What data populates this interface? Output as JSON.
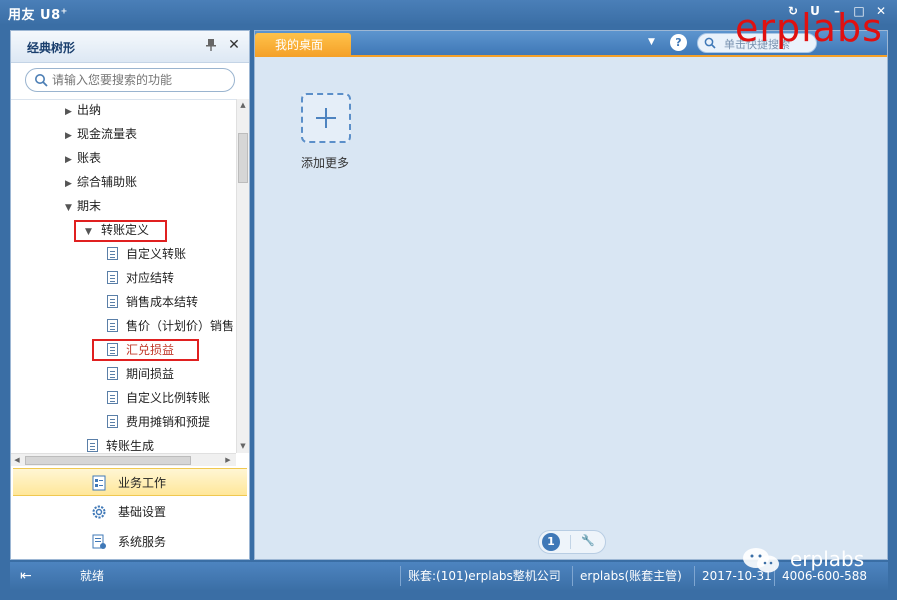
{
  "app": {
    "title": "用友 U8",
    "title_sup": "+"
  },
  "window_controls": [
    "↻",
    "U",
    "–",
    "□",
    "✕"
  ],
  "left_panel": {
    "title": "经典树形",
    "search_placeholder": "请输入您要搜索的功能",
    "tree": [
      {
        "label": "出纳",
        "type": "folder",
        "state": "collapsed"
      },
      {
        "label": "现金流量表",
        "type": "folder",
        "state": "collapsed"
      },
      {
        "label": "账表",
        "type": "folder",
        "state": "collapsed"
      },
      {
        "label": "综合辅助账",
        "type": "folder",
        "state": "collapsed"
      },
      {
        "label": "期末",
        "type": "folder",
        "state": "expanded"
      },
      {
        "label": "转账定义",
        "type": "folder",
        "state": "expanded",
        "highlight": true
      },
      {
        "label": "自定义转账",
        "type": "doc"
      },
      {
        "label": "对应结转",
        "type": "doc"
      },
      {
        "label": "销售成本结转",
        "type": "doc"
      },
      {
        "label": "售价（计划价）销售",
        "type": "doc"
      },
      {
        "label": "汇兑损益",
        "type": "doc",
        "highlight": true
      },
      {
        "label": "期间损益",
        "type": "doc"
      },
      {
        "label": "自定义比例转账",
        "type": "doc"
      },
      {
        "label": "费用摊销和预提",
        "type": "doc"
      },
      {
        "label": "转账生成",
        "type": "doc"
      }
    ],
    "nav_buttons": [
      {
        "label": "业务工作",
        "icon": "business-work-icon",
        "active": true
      },
      {
        "label": "基础设置",
        "icon": "gear-icon",
        "active": false
      },
      {
        "label": "系统服务",
        "icon": "system-service-icon",
        "active": false
      }
    ]
  },
  "right_panel": {
    "tab_label": "我的桌面",
    "search_placeholder": "单击快捷搜索",
    "add_more_label": "添加更多",
    "pager_page": "1"
  },
  "status_bar": {
    "status": "就绪",
    "account": "账套:(101)erplabs整机公司",
    "user": "erplabs(账套主管)",
    "date": "2017-10-31",
    "phone": "4006-600-588"
  },
  "watermark": {
    "top": "erplabs",
    "bottom": "erplabs"
  },
  "colors": {
    "accent_orange": "#f4a028",
    "title_blue": "#3b6fa6",
    "highlight_red": "#e02020",
    "active_item_text": "#c0392b"
  }
}
